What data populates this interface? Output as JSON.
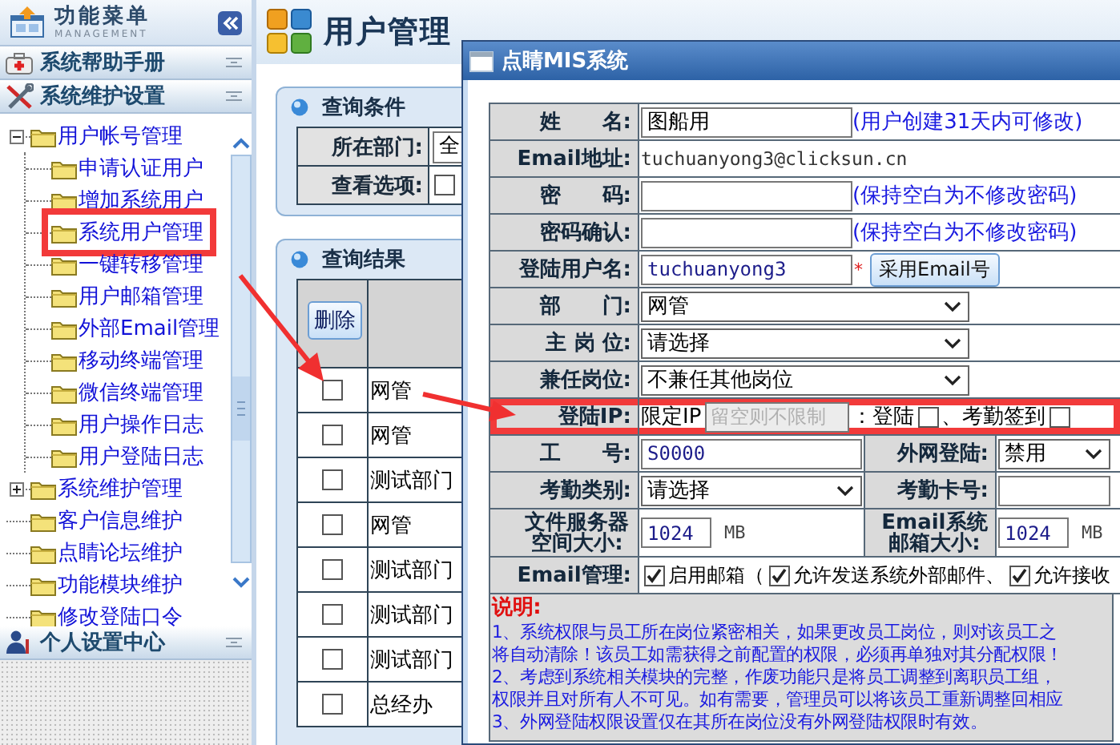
{
  "sidebar": {
    "title": "功能菜单",
    "subtitle": "MANAGEMENT",
    "sections": [
      {
        "label": "系统帮助手册"
      },
      {
        "label": "系统维护设置",
        "tree": [
          {
            "label": "用户帐号管理",
            "expanded": true,
            "highlighted": false,
            "children": [
              {
                "label": "申请认证用户",
                "highlighted": false
              },
              {
                "label": "增加系统用户",
                "highlighted": false
              },
              {
                "label": "系统用户管理",
                "highlighted": true
              },
              {
                "label": "一键转移管理",
                "highlighted": false
              },
              {
                "label": "用户邮箱管理",
                "highlighted": false
              },
              {
                "label": "外部Email管理",
                "highlighted": false
              },
              {
                "label": "移动终端管理",
                "highlighted": false
              },
              {
                "label": "微信终端管理",
                "highlighted": false
              },
              {
                "label": "用户操作日志",
                "highlighted": false
              },
              {
                "label": "用户登陆日志",
                "highlighted": false
              }
            ]
          },
          {
            "label": "系统维护管理",
            "expanded": false,
            "highlighted": false
          },
          {
            "label": "客户信息维护",
            "highlighted": false
          },
          {
            "label": "点睛论坛维护",
            "highlighted": false
          },
          {
            "label": "功能模块维护",
            "highlighted": false
          },
          {
            "label": "修改登陆口令",
            "highlighted": false
          }
        ]
      },
      {
        "label": "个人设置中心"
      }
    ]
  },
  "page": {
    "title": "用户管理",
    "query_panel": {
      "title": "查询条件",
      "rows": [
        {
          "kind": "select",
          "label": "所在部门:",
          "value": "全"
        },
        {
          "kind": "checkbox",
          "label": "查看选项:",
          "checked": false
        }
      ]
    },
    "results_panel": {
      "title": "查询结果",
      "delete_button": "删除",
      "rows": [
        {
          "checked": false,
          "department": "网管"
        },
        {
          "checked": false,
          "department": "网管"
        },
        {
          "checked": false,
          "department": "测试部门"
        },
        {
          "checked": false,
          "department": "网管"
        },
        {
          "checked": false,
          "department": "测试部门"
        },
        {
          "checked": false,
          "department": "测试部门"
        },
        {
          "checked": false,
          "department": "测试部门"
        },
        {
          "checked": false,
          "department": "总经办"
        }
      ]
    }
  },
  "dialog": {
    "title": "点睛MIS系统",
    "rows": [
      {
        "kind": "input",
        "label": "姓　　名:",
        "value": "图船用",
        "note": "(用户创建31天内可修改)"
      },
      {
        "kind": "text",
        "label": "Email地址:",
        "value": "tuchuanyong3@clicksun.cn"
      },
      {
        "kind": "input",
        "label": "密　　码:",
        "note": "(保持空白为不修改密码)"
      },
      {
        "kind": "input",
        "label": "密码确认:",
        "note": "(保持空白为不修改密码)"
      },
      {
        "kind": "input",
        "label": "登陆用户名:",
        "value": "tuchuanyong3",
        "required_mark": "*",
        "button": "采用Email号"
      },
      {
        "kind": "select",
        "label": "部　　门:",
        "value": "网管"
      },
      {
        "kind": "select",
        "label": "主 岗 位:",
        "value": "请选择"
      },
      {
        "kind": "select",
        "label": "兼任岗位:",
        "value": "不兼任其他岗位"
      },
      {
        "kind": "ip",
        "label": "登陆IP:",
        "prefix": "限定IP",
        "placeholder": "留空则不限制",
        "highlighted": true,
        "options": [
          {
            "label": "：登陆",
            "checked": false
          },
          {
            "label": "、考勤签到",
            "checked": false
          }
        ]
      },
      {
        "kind": "split",
        "cells": [
          {
            "kind": "input",
            "label": "工　　号:",
            "value": "S0000"
          },
          {
            "kind": "select",
            "label": "外网登陆:",
            "value": "禁用"
          }
        ]
      },
      {
        "kind": "split",
        "cells": [
          {
            "kind": "select",
            "label": "考勤类别:",
            "value": "请选择"
          },
          {
            "kind": "input",
            "label": "考勤卡号:"
          }
        ]
      },
      {
        "kind": "split",
        "cells": [
          {
            "kind": "size",
            "label": "文件服务器空间大小:",
            "value": "1024",
            "unit": "MB"
          },
          {
            "kind": "size",
            "label": "Email系统邮箱大小:",
            "value": "1024",
            "unit": "MB"
          }
        ]
      },
      {
        "kind": "checks",
        "label": "Email管理:",
        "options": [
          {
            "label": "启用邮箱（",
            "checked": true
          },
          {
            "label": "允许发送系统外部邮件、",
            "checked": true
          },
          {
            "label": "允许接收",
            "checked": true
          }
        ]
      }
    ],
    "notes": {
      "heading": "说明:",
      "lines": [
        "1、系统权限与员工所在岗位紧密相关，如果更改员工岗位，则对该员工之",
        "将自动清除！该员工如需获得之前配置的权限，必须再单独对其分配权限！",
        "2、考虑到系统相关模块的完整，作废功能只是将员工调整到离职员工组，",
        "权限并且对所有人不可见。如有需要，管理员可以将该员工重新调整回相应",
        "3、外网登陆权限设置仅在其所在岗位没有外网登陆权限时有效。"
      ]
    }
  }
}
